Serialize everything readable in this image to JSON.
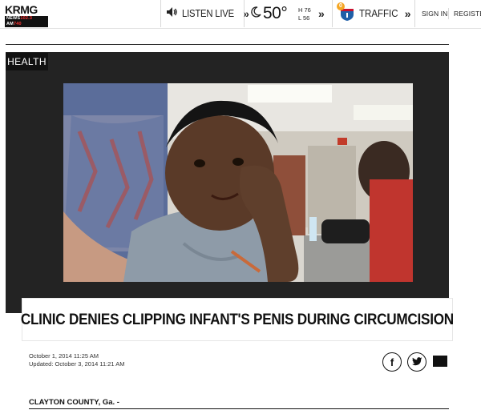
{
  "header": {
    "logo_word": "KRMG",
    "logo_sub_a": "NEWS",
    "logo_sub_b": "102.3",
    "logo_sub_c": "AM",
    "logo_sub_d": "740",
    "listen_label": "LISTEN LIVE",
    "weather": {
      "temp": "50°",
      "high": "H 76",
      "low": "L 56"
    },
    "traffic_label": "TRAFFIC",
    "traffic_count": "0",
    "traffic_route": "I",
    "signin_label": "SIGN IN",
    "register_label": "REGISTER"
  },
  "article": {
    "category": "HEALTH",
    "headline": "CLINIC DENIES CLIPPING INFANT'S PENIS DURING CIRCUMCISION",
    "published": "October 1, 2014 11:25 AM",
    "updated": "Updated: October 3, 2014 11:21 AM",
    "dateline": "CLAYTON COUNTY, Ga. -"
  },
  "social": {
    "facebook_glyph": "f"
  },
  "colors": {
    "hero_bg": "#232323",
    "accent_orange": "#f5a623",
    "interstate_blue": "#1f5fa8",
    "interstate_red": "#c8102e"
  },
  "icons": [
    "speaker-icon",
    "chevron-right-icon",
    "weather-moon-icon",
    "interstate-shield-icon",
    "facebook-icon",
    "twitter-icon",
    "email-icon"
  ]
}
